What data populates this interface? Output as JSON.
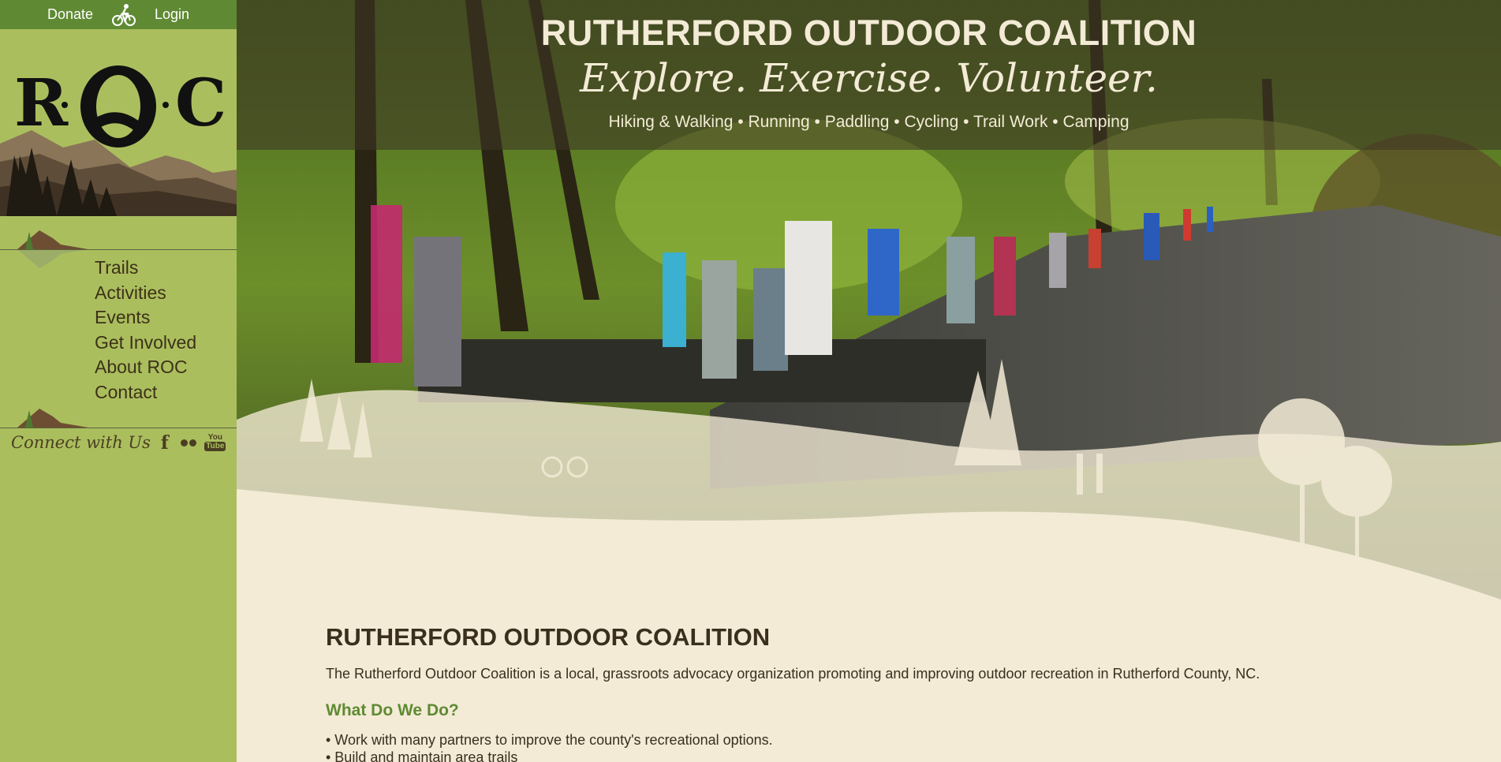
{
  "topbar": {
    "donate": "Donate",
    "login": "Login"
  },
  "logo": {
    "letters": "R·O·C",
    "subtitle": "RUTHERFORD OUTDOOR COALITION"
  },
  "nav": {
    "items": [
      "Trails",
      "Activities",
      "Events",
      "Get Involved",
      "About ROC",
      "Contact"
    ]
  },
  "social": {
    "label": "Connect with Us",
    "youtube_top": "You",
    "youtube_bottom": "Tube"
  },
  "banner": {
    "title": "RUTHERFORD OUTDOOR COALITION",
    "tagline": "Explore. Exercise. Volunteer.",
    "activities": "Hiking & Walking • Running • Paddling • Cycling • Trail Work • Camping"
  },
  "content": {
    "heading": "RUTHERFORD OUTDOOR COALITION",
    "intro": "The Rutherford Outdoor Coalition is a local, grassroots advocacy organization promoting and improving outdoor recreation in Rutherford County, NC.",
    "subheading": "What Do We Do?",
    "bullets": [
      "• Work with many partners to improve the county's recreational options.",
      "• Build and maintain area trails"
    ]
  },
  "colors": {
    "sidebar": "#abbe5e",
    "topbar": "#5f8a33",
    "cream": "#f3ebd6",
    "dark_brown": "#3a2e1c",
    "accent_green": "#5f8a33"
  }
}
